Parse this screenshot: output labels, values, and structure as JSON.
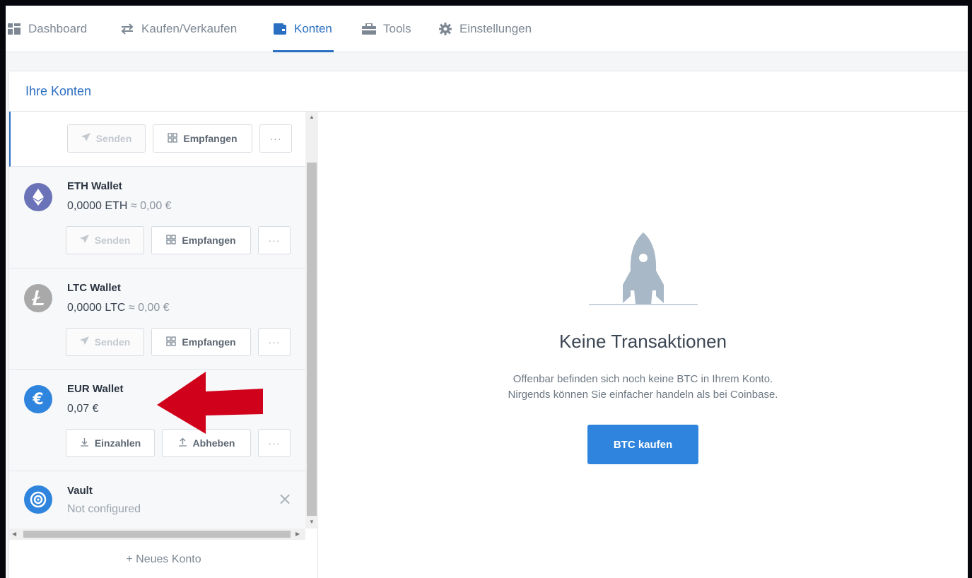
{
  "nav": {
    "items": [
      {
        "label": "Dashboard",
        "icon": "dashboard-icon"
      },
      {
        "label": "Kaufen/Verkaufen",
        "icon": "swap-arrows-icon"
      },
      {
        "label": "Konten",
        "icon": "wallet-icon",
        "active": true
      },
      {
        "label": "Tools",
        "icon": "toolbox-icon"
      },
      {
        "label": "Einstellungen",
        "icon": "gear-icon"
      }
    ]
  },
  "panel": {
    "title": "Ihre Konten"
  },
  "accounts": [
    {
      "name": "",
      "balance": "",
      "buttons": [
        "Senden",
        "Empfangen",
        "···"
      ]
    },
    {
      "name": "ETH Wallet",
      "balance_amount": "0,0000 ETH",
      "balance_fiat": "≈ 0,00 €",
      "buttons": [
        "Senden",
        "Empfangen",
        "···"
      ]
    },
    {
      "name": "LTC Wallet",
      "balance_amount": "0,0000 LTC",
      "balance_fiat": "≈ 0,00 €",
      "buttons": [
        "Senden",
        "Empfangen",
        "···"
      ]
    },
    {
      "name": "EUR Wallet",
      "balance_amount": "0,07 €",
      "balance_fiat": "",
      "buttons": [
        "Einzahlen",
        "Abheben",
        "···"
      ]
    },
    {
      "name": "Vault",
      "balance_amount": "Not configured",
      "close": "×"
    }
  ],
  "new_account": "+ Neues Konto",
  "main": {
    "empty_title": "Keine Transaktionen",
    "empty_line1": "Offenbar befinden sich noch keine BTC in Ihrem Konto.",
    "empty_line2": "Nirgends können Sie einfacher handeln als bei Coinbase.",
    "buy_button": "BTC kaufen"
  },
  "colors": {
    "accent": "#2b6fc2",
    "button": "#2f85dd",
    "eth": "#6b73b8",
    "ltc": "#a9a9a9",
    "eur": "#2f85dd",
    "vault": "#2f85dd",
    "annotation_arrow": "#d0021b"
  }
}
